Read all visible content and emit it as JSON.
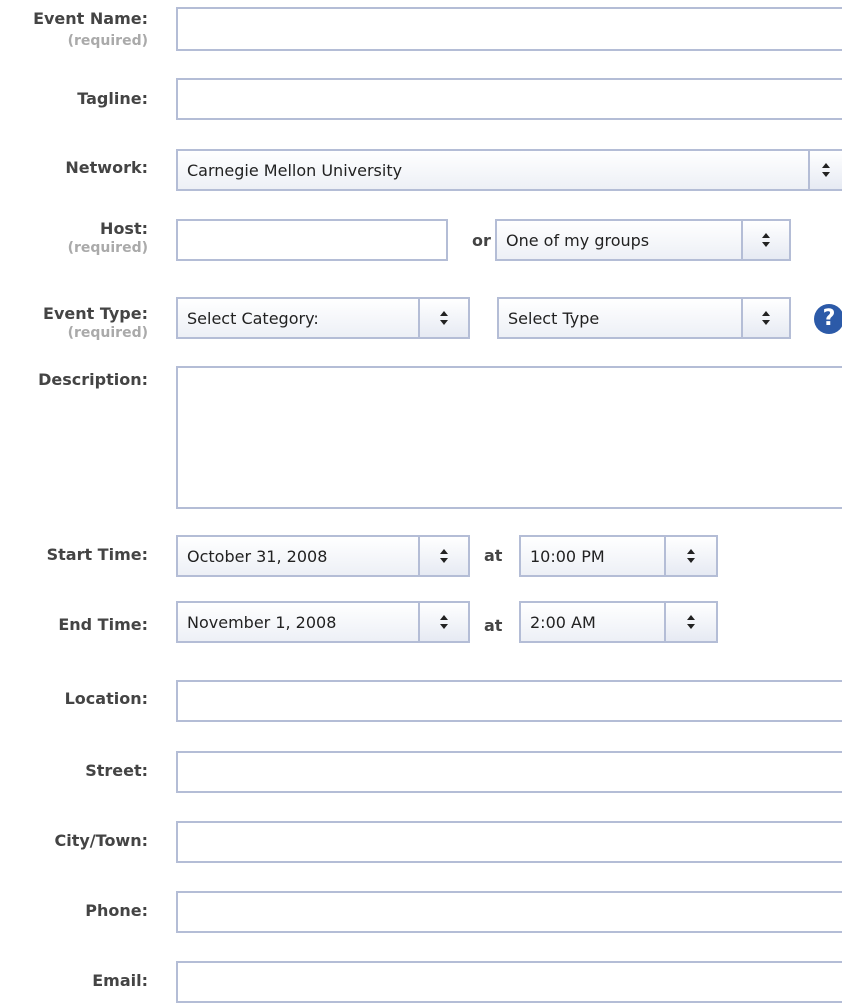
{
  "fields": {
    "event_name": {
      "label": "Event Name:",
      "required": "(required)",
      "value": ""
    },
    "tagline": {
      "label": "Tagline:",
      "value": ""
    },
    "network": {
      "label": "Network:",
      "selected": "Carnegie Mellon University"
    },
    "host": {
      "label": "Host:",
      "required": "(required)",
      "value": "",
      "connector": "or",
      "group_selected": "One of my groups"
    },
    "event_type": {
      "label": "Event Type:",
      "required": "(required)",
      "category_selected": "Select Category:",
      "type_selected": "Select Type",
      "help_glyph": "?"
    },
    "description": {
      "label": "Description:",
      "value": ""
    },
    "start_time": {
      "label": "Start Time:",
      "date_selected": "October 31, 2008",
      "connector": "at",
      "time_selected": "10:00 PM"
    },
    "end_time": {
      "label": "End Time:",
      "date_selected": "November 1, 2008",
      "connector": "at",
      "time_selected": "2:00 AM"
    },
    "location": {
      "label": "Location:",
      "value": ""
    },
    "street": {
      "label": "Street:",
      "value": ""
    },
    "city": {
      "label": "City/Town:",
      "value": ""
    },
    "phone": {
      "label": "Phone:",
      "value": ""
    },
    "email": {
      "label": "Email:",
      "value": ""
    }
  },
  "icons": {
    "select_arrow": "up-down-arrows-icon",
    "help": "help-icon"
  },
  "colors": {
    "border": "#b4bdd6",
    "label": "#444444",
    "required": "#aaaaaa",
    "help": "#2c5aa8"
  }
}
